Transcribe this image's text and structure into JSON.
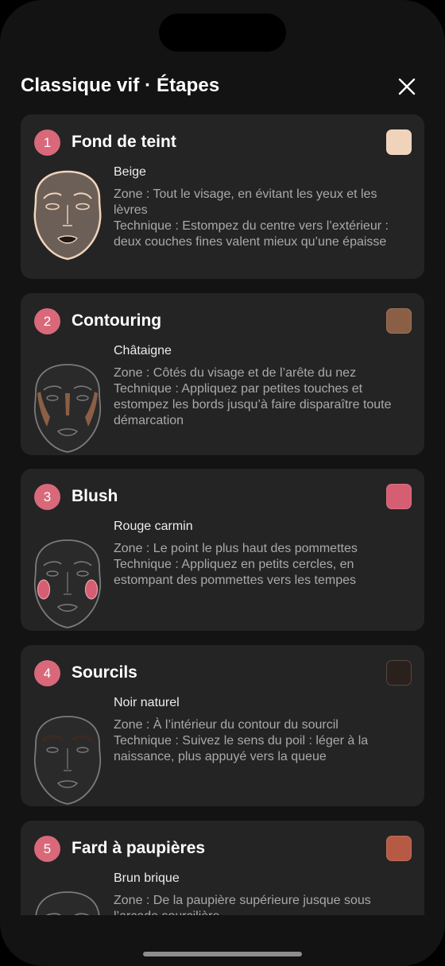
{
  "header": {
    "title": "Classique vif · Étapes"
  },
  "steps": [
    {
      "number": "1",
      "title": "Fond de teint",
      "color": "#f0d3bb",
      "shade": "Beige",
      "zone": "Zone : Tout le visage, en évitant les yeux et les lèvres",
      "technique": "Technique : Estompez du centre vers l’extérieur : deux couches fines valent mieux qu’une épaisse"
    },
    {
      "number": "2",
      "title": "Contouring",
      "color": "#8b5f45",
      "shade": "Châtaigne",
      "zone": "Zone : Côtés du visage et de l’arête du nez",
      "technique": "Technique : Appliquez par petites touches et estompez les bords jusqu’à faire disparaître toute démarcation"
    },
    {
      "number": "3",
      "title": "Blush",
      "color": "#d65e72",
      "shade": "Rouge carmin",
      "zone": "Zone : Le point le plus haut des pommettes",
      "technique": "Technique : Appliquez en petits cercles, en estompant des pommettes vers les tempes"
    },
    {
      "number": "4",
      "title": "Sourcils",
      "color": "#2a201c",
      "shade": "Noir naturel",
      "zone": "Zone : À l’intérieur du contour du sourcil",
      "technique": "Technique : Suivez le sens du poil : léger à la naissance, plus appuyé vers la queue"
    },
    {
      "number": "5",
      "title": "Fard à paupières",
      "color": "#b65a45",
      "shade": "Brun brique",
      "zone": "Zone : De la paupière supérieure jusque sous l’arcade sourcilière",
      "technique": ""
    }
  ],
  "icons": {
    "close": "close-icon",
    "face": "face-diagram"
  }
}
